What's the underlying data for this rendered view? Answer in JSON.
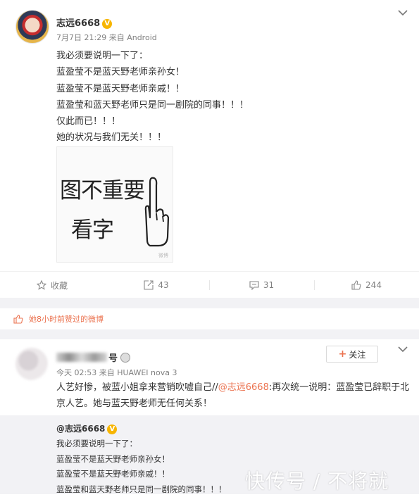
{
  "post1": {
    "author": "志远6668",
    "verified_badge": "V",
    "time": "7月7日 21:29",
    "source": "来自 Android",
    "lines": [
      "我必须要说明一下了：",
      "蓝盈莹不是蓝天野老师亲孙女！",
      "蓝盈莹不是蓝天野老师亲戚！！",
      "蓝盈莹和蓝天野老师只是同一剧院的同事！！！",
      "仅此而已！！！",
      "她的状况与我们无关！！！"
    ],
    "image": {
      "line1": "图不重要",
      "line2": "看字",
      "watermark": "微博"
    },
    "actions": {
      "favorite": "收藏",
      "repost": "43",
      "comment": "31",
      "like": "244"
    }
  },
  "liked_notice": "她8小时前赞过的微博",
  "post2": {
    "author_tail": "号",
    "follow_label": "关注",
    "time": "今天 02:53",
    "source": "来自 HUAWEI nova 3",
    "text_before": "人艺好惨，被蓝小姐拿来营销吹嘘自己//",
    "mention": "@志远6668",
    "text_after": ":再次统一说明：蓝盈莹已辞职于北京人艺。她与蓝天野老师无任何关系！",
    "repost_author": "@志远6668",
    "repost_lines": [
      "我必须要说明一下了：",
      "蓝盈莹不是蓝天野老师亲孙女！",
      "蓝盈莹不是蓝天野老师亲戚！！",
      "蓝盈莹和蓝天野老师只是同一剧院的同事！！！"
    ]
  },
  "watermark": "快传号 / 不将就",
  "colors": {
    "accent": "#eb7350",
    "badge": "#f7b500",
    "meta": "#808080",
    "bg_gray": "#f2f2f5"
  }
}
